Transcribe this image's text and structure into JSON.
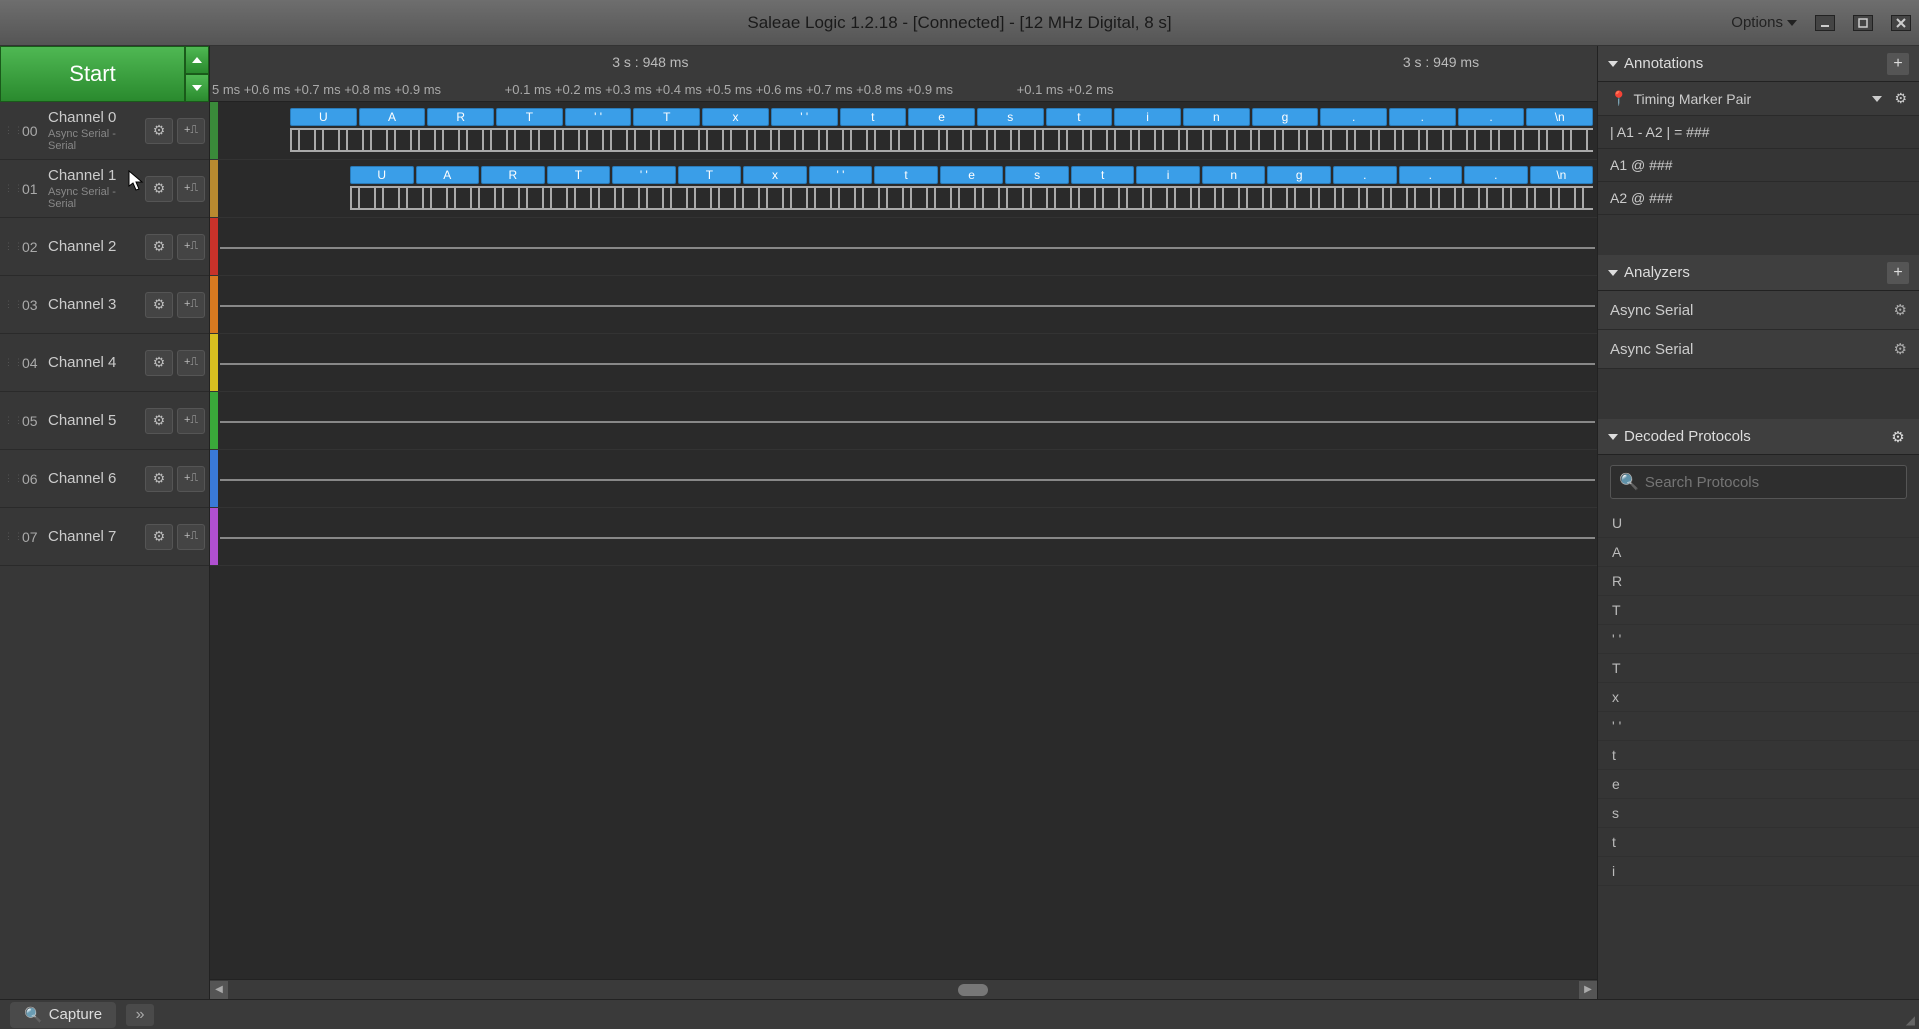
{
  "title": "Saleae Logic 1.2.18 - [Connected] - [12 MHz Digital, 8 s]",
  "options_label": "Options",
  "start_label": "Start",
  "channels": [
    {
      "num": "00",
      "name": "Channel 0",
      "sub": "Async Serial - Serial",
      "color": "#3a8a3a",
      "pulses": true
    },
    {
      "num": "01",
      "name": "Channel 1",
      "sub": "Async Serial - Serial",
      "color": "#b88a30",
      "pulses": true
    },
    {
      "num": "02",
      "name": "Channel 2",
      "sub": "",
      "color": "#c8322a",
      "pulses": false
    },
    {
      "num": "03",
      "name": "Channel 3",
      "sub": "",
      "color": "#d87a20",
      "pulses": false
    },
    {
      "num": "04",
      "name": "Channel 4",
      "sub": "",
      "color": "#d8c020",
      "pulses": false
    },
    {
      "num": "05",
      "name": "Channel 5",
      "sub": "",
      "color": "#3aa83a",
      "pulses": false
    },
    {
      "num": "06",
      "name": "Channel 6",
      "sub": "",
      "color": "#3a7ad8",
      "pulses": false
    },
    {
      "num": "07",
      "name": "Channel 7",
      "sub": "",
      "color": "#b050d0",
      "pulses": false
    }
  ],
  "time_majors": [
    {
      "label": "3 s : 948 ms",
      "pos": 29
    },
    {
      "label": "3 s : 949 ms",
      "pos": 86
    }
  ],
  "time_ticksA": "5 ms +0.6 ms +0.7 ms +0.8 ms +0.9 ms",
  "time_ticksB": "+0.1 ms +0.2 ms +0.3 ms +0.4 ms +0.5 ms +0.6 ms +0.7 ms +0.8 ms +0.9 ms",
  "time_ticksC": "+0.1 ms +0.2 ms",
  "proto_chars": [
    "U",
    "A",
    "R",
    "T",
    "' '",
    "T",
    "x",
    "' '",
    "t",
    "e",
    "s",
    "t",
    "i",
    "n",
    "g",
    ".",
    ".",
    ".",
    "\\n"
  ],
  "annotations": {
    "header": "Annotations",
    "pair_label": "Timing Marker Pair",
    "diff": "| A1 - A2 | = ###",
    "a1": "A1  @  ###",
    "a2": "A2  @  ###"
  },
  "analyzers": {
    "header": "Analyzers",
    "items": [
      "Async Serial",
      "Async Serial"
    ]
  },
  "decoded": {
    "header": "Decoded Protocols",
    "placeholder": "Search Protocols",
    "items": [
      "U",
      "A",
      "R",
      "T",
      "' '",
      "T",
      "x",
      "' '",
      "t",
      "e",
      "s",
      "t",
      "i"
    ]
  },
  "capture_label": "Capture"
}
